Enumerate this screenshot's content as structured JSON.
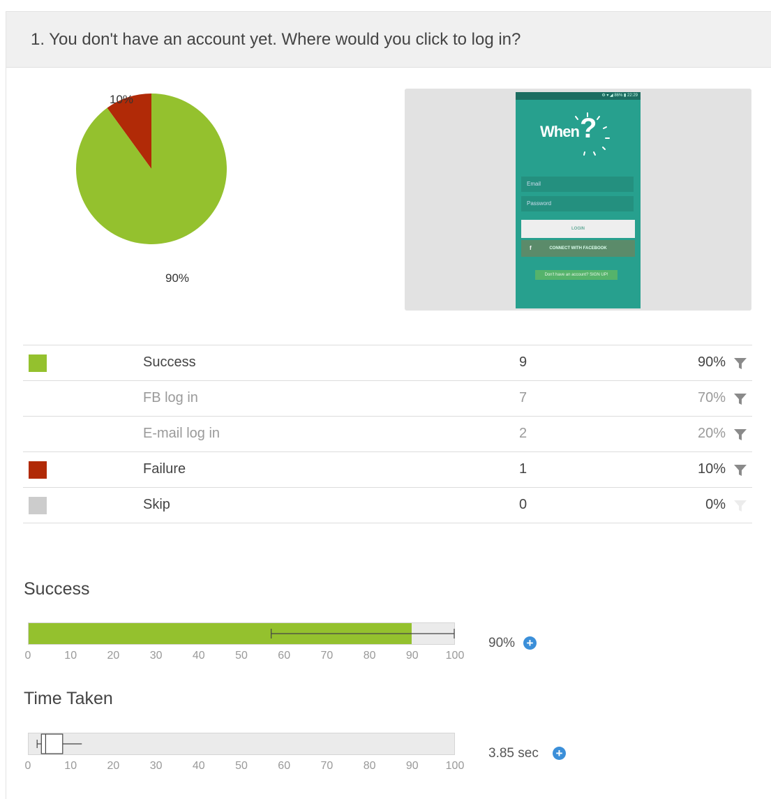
{
  "question": {
    "number": "1.",
    "text": "You don't have an account yet. Where would you click to log in?"
  },
  "colors": {
    "success": "#94c12e",
    "failure": "#b12a07",
    "skip": "#cccccc",
    "accent": "#3b8fd9",
    "app_teal": "#27a08e"
  },
  "pie": {
    "labels": [
      "10%",
      "90%"
    ]
  },
  "chart_data": {
    "type": "pie",
    "categories": [
      "Success",
      "Failure"
    ],
    "values": [
      90,
      10
    ],
    "colors": [
      "#94c12e",
      "#b12a07"
    ]
  },
  "preview": {
    "status": "⚙ ▾ ◢ 86% ▮ 22:29",
    "logo": "When",
    "email_placeholder": "Email",
    "password_placeholder": "Password",
    "login_label": "LOGIN",
    "facebook_label": "CONNECT WITH FACEBOOK",
    "signup_label": "Don't have an account? SIGN UP!"
  },
  "results": [
    {
      "label": "Success",
      "count": "9",
      "percent": "90%",
      "swatch": "#94c12e",
      "sub": false,
      "filter": "active"
    },
    {
      "label": "FB log in",
      "count": "7",
      "percent": "70%",
      "swatch": "",
      "sub": true,
      "filter": "active"
    },
    {
      "label": "E-mail log in",
      "count": "2",
      "percent": "20%",
      "swatch": "",
      "sub": true,
      "filter": "active"
    },
    {
      "label": "Failure",
      "count": "1",
      "percent": "10%",
      "swatch": "#b12a07",
      "sub": false,
      "filter": "active"
    },
    {
      "label": "Skip",
      "count": "0",
      "percent": "0%",
      "swatch": "#cccccc",
      "sub": false,
      "filter": "inactive"
    }
  ],
  "success_section": {
    "title": "Success",
    "value_label": "90%",
    "success_rate": 90,
    "interval": [
      57,
      100
    ],
    "axis_ticks": [
      "0",
      "10",
      "20",
      "30",
      "40",
      "50",
      "60",
      "70",
      "80",
      "90",
      "100"
    ]
  },
  "time_section": {
    "title": "Time Taken",
    "value_label": "3.85 sec",
    "box": {
      "whisker_low": 2,
      "q1": 3,
      "median": 4,
      "q3": 8,
      "whisker_high": 12.5
    },
    "axis_ticks": [
      "0",
      "10",
      "20",
      "30",
      "40",
      "50",
      "60",
      "70",
      "80",
      "90",
      "100"
    ]
  }
}
